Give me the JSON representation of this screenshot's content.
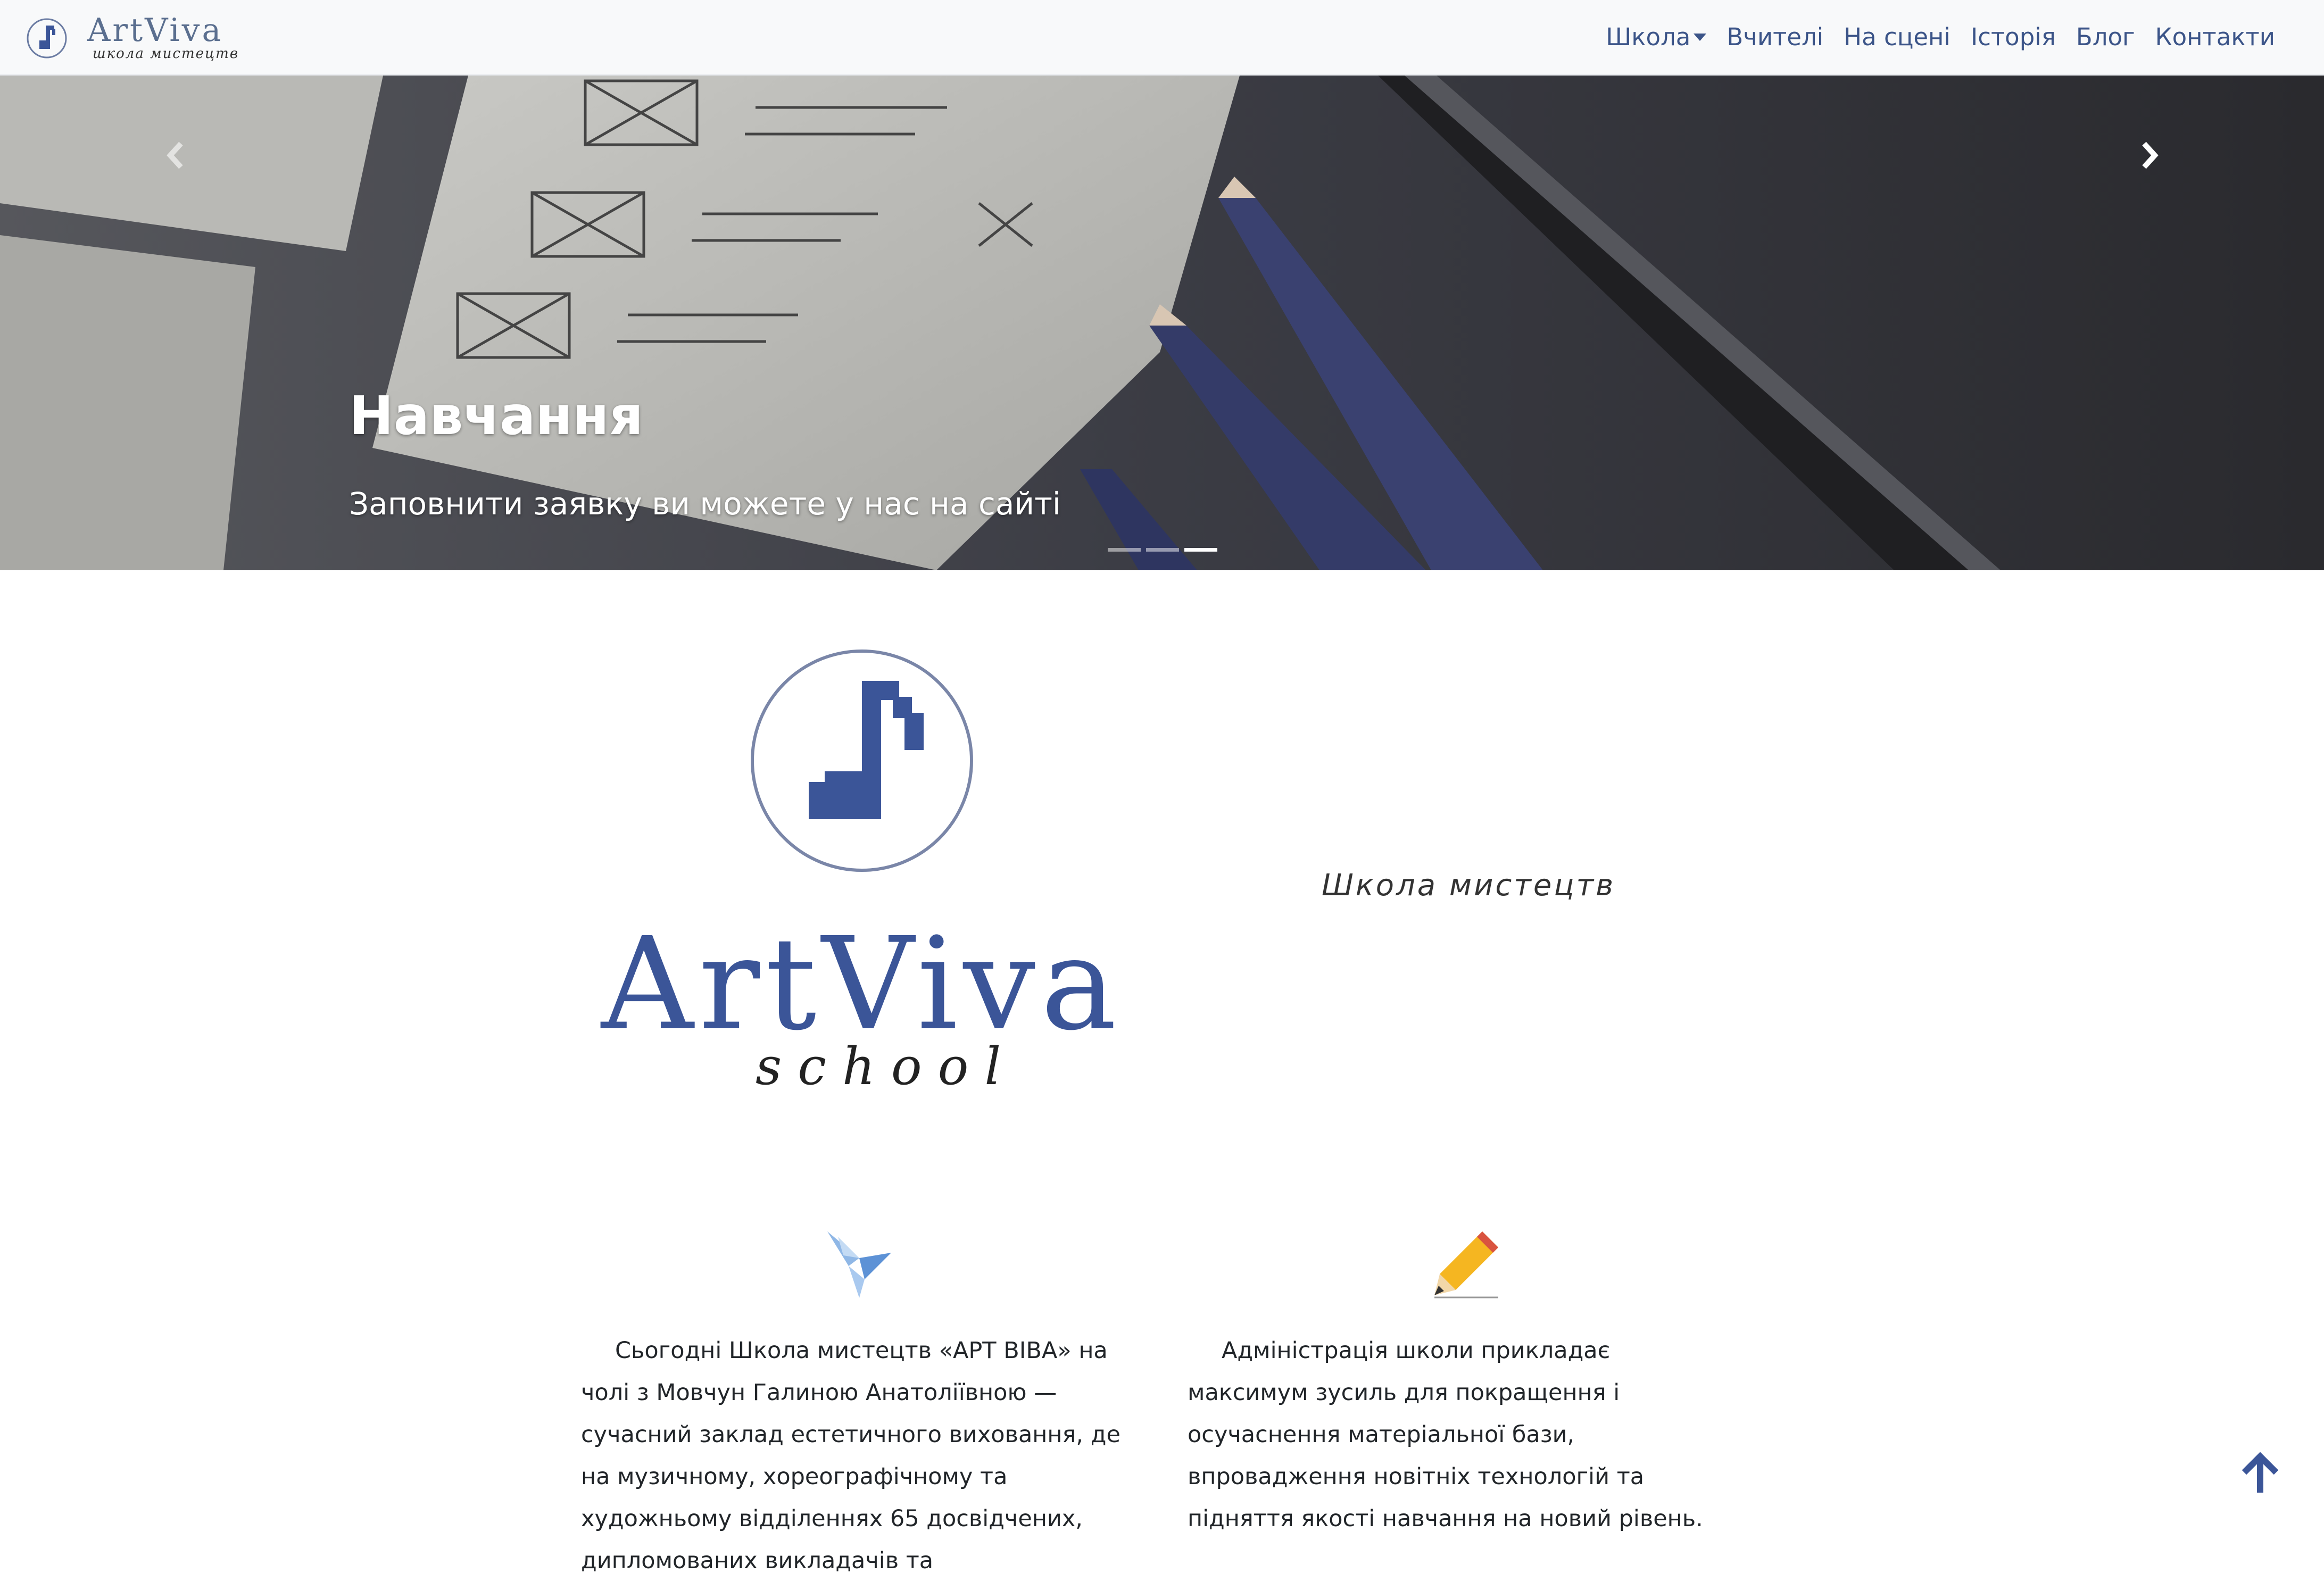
{
  "brand": {
    "name": "ArtViva",
    "subtitle": "школа мистецтв",
    "logo_icon": "music-note-icon"
  },
  "nav": {
    "items": [
      {
        "label": "Школа",
        "dropdown": true
      },
      {
        "label": "Вчителі"
      },
      {
        "label": "На сцені"
      },
      {
        "label": "Історія"
      },
      {
        "label": "Блог"
      },
      {
        "label": "Контакти"
      }
    ],
    "link_color": "#3b5488"
  },
  "carousel": {
    "slide_title": "Навчання",
    "slide_text": "Заповнити заявку ви можете у нас на сайті",
    "indicator_count": 3,
    "active_indicator": 3,
    "prev_icon": "chevron-left-icon",
    "next_icon": "chevron-right-icon"
  },
  "intro": {
    "logo_name": "ArtViva",
    "logo_sub": "school",
    "tagline": "Школа мистецтв",
    "brand_color": "#3b5598"
  },
  "features": [
    {
      "icon": "origami-bird-icon",
      "text": "Сьогодні Школа мистецтв «АРТ ВІВА» на чолі з Мовчун Галиною Анатоліївною — сучасний заклад естетичного виховання, де на музичному, хореографічному та художньому відділеннях 65 досвідчених, дипломованих викладачів та"
    },
    {
      "icon": "pencil-icon",
      "text": "Адміністрація школи прикладає максимум зусиль для покращення і осучаснення матеріальної бази, впровадження новітніх технологій та підняття якості навчання на новий рівень."
    }
  ],
  "back_to_top": {
    "icon": "arrow-up-icon"
  }
}
